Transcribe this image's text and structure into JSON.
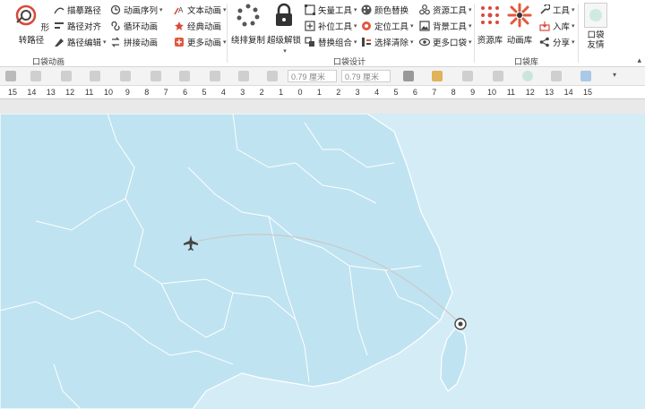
{
  "ribbon": {
    "group_anim": {
      "label": "口袋动画",
      "shape_path": "形转路径",
      "items": [
        {
          "label": "描摹路径",
          "caret": false
        },
        {
          "label": "路径对齐",
          "caret": false
        },
        {
          "label": "路径编辑",
          "caret": true
        },
        {
          "label": "动画序列",
          "caret": true
        },
        {
          "label": "循环动画",
          "caret": false
        },
        {
          "label": "拼接动画",
          "caret": false
        },
        {
          "label": "文本动画",
          "caret": true
        },
        {
          "label": "经典动画",
          "caret": false
        },
        {
          "label": "更多动画",
          "caret": true
        }
      ]
    },
    "group_design": {
      "label": "口袋设计",
      "wrap_copy": "绕排复制",
      "super_unlock": "超级解锁",
      "items": [
        {
          "label": "矢量工具",
          "caret": true
        },
        {
          "label": "补位工具",
          "caret": true
        },
        {
          "label": "替换组合",
          "caret": true
        },
        {
          "label": "颜色替换",
          "caret": false
        },
        {
          "label": "定位工具",
          "caret": true
        },
        {
          "label": "选择清除",
          "caret": true
        },
        {
          "label": "资源工具",
          "caret": true
        },
        {
          "label": "背景工具",
          "caret": true
        },
        {
          "label": "更多口袋",
          "caret": true
        }
      ]
    },
    "group_lib": {
      "label": "口袋库",
      "resource_lib": "资源库",
      "anim_lib": "动画库",
      "items": [
        {
          "label": "工具",
          "caret": true
        },
        {
          "label": "入库",
          "caret": true
        },
        {
          "label": "分享",
          "caret": true
        }
      ]
    },
    "friend": "口袋友情"
  },
  "toolbar": {
    "width_value": "0.79 厘米",
    "height_value": "0.79 厘米"
  },
  "ruler": {
    "labels": [
      "15",
      "14",
      "13",
      "12",
      "11",
      "10",
      "9",
      "8",
      "7",
      "6",
      "5",
      "4",
      "3",
      "2",
      "1",
      "0",
      "1",
      "2",
      "3",
      "4",
      "5",
      "6",
      "7",
      "8",
      "9",
      "10",
      "11",
      "12",
      "13",
      "14",
      "15"
    ]
  },
  "colors": {
    "sea": "#d4ecf6",
    "land": "#bfe3f1",
    "border": "#ffffff",
    "route": "#c9c9c9"
  },
  "icons": {
    "start": "airplane-icon",
    "end": "target-marker-icon"
  }
}
